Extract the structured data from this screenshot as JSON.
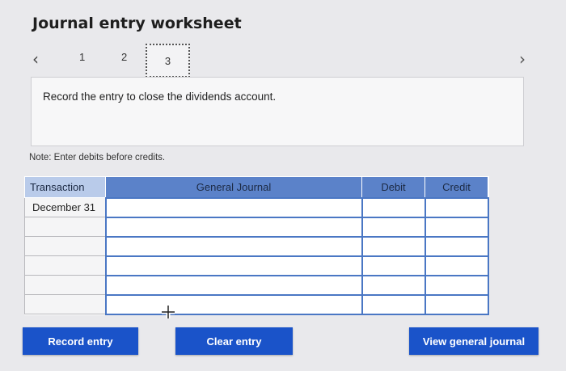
{
  "title": "Journal entry worksheet",
  "pager": {
    "prev_icon": "‹",
    "next_icon": "›",
    "pages": [
      "1",
      "2",
      "3"
    ],
    "current": "3"
  },
  "instruction": "Record the entry to close the dividends account.",
  "note": "Note: Enter debits before credits.",
  "table": {
    "headers": [
      "Transaction",
      "General Journal",
      "Debit",
      "Credit"
    ],
    "rows": [
      {
        "transaction": "December 31"
      },
      {
        "transaction": ""
      },
      {
        "transaction": ""
      },
      {
        "transaction": ""
      },
      {
        "transaction": ""
      },
      {
        "transaction": ""
      }
    ]
  },
  "buttons": {
    "record": "Record entry",
    "clear": "Clear entry",
    "view": "View general journal"
  },
  "colors": {
    "accent": "#1a53c9",
    "header": "#5b82c9",
    "header_first": "#b9cbea"
  }
}
